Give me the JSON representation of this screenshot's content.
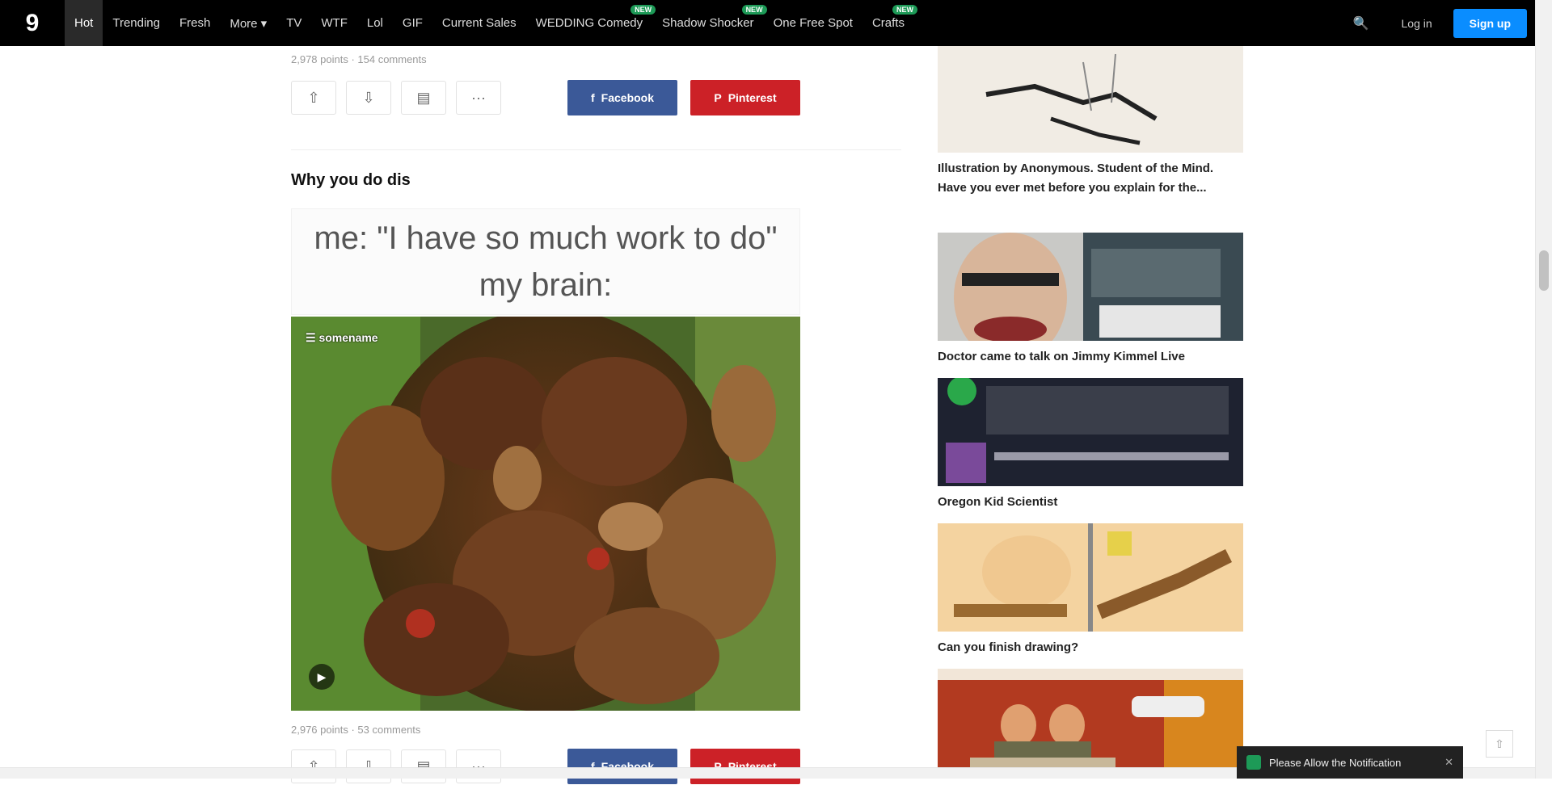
{
  "nav": {
    "logo": "9",
    "items": [
      {
        "label": "Hot",
        "active": true,
        "badge": ""
      },
      {
        "label": "Trending",
        "active": false,
        "badge": ""
      },
      {
        "label": "Fresh",
        "active": false,
        "badge": ""
      },
      {
        "label": "More ▾",
        "active": false,
        "badge": ""
      },
      {
        "label": "TV",
        "active": false,
        "badge": ""
      },
      {
        "label": "WTF",
        "active": false,
        "badge": ""
      },
      {
        "label": "Lol",
        "active": false,
        "badge": ""
      },
      {
        "label": "GIF",
        "active": false,
        "badge": ""
      },
      {
        "label": "Current Sales",
        "active": false,
        "badge": ""
      },
      {
        "label": "WEDDING Comedy",
        "active": false,
        "badge": "NEW"
      },
      {
        "label": "Shadow Shocker",
        "active": false,
        "badge": "NEW"
      },
      {
        "label": "One Free Spot",
        "active": false,
        "badge": ""
      },
      {
        "label": "Crafts",
        "active": false,
        "badge": "NEW"
      }
    ],
    "search_icon": "🔍",
    "login_label": "Log in",
    "signup_label": "Sign up"
  },
  "posts": [
    {
      "meta": "2,978 points · 154 comments",
      "facebook_label": "Facebook",
      "pinterest_label": "Pinterest"
    },
    {
      "title": "Why you do dis",
      "caption_line1": "me: \"I have so much work to do\"",
      "caption_line2": "my brain:",
      "watermark": "☰ somename",
      "play_icon": "▶",
      "meta": "2,976 points · 53 comments",
      "facebook_label": "Facebook",
      "pinterest_label": "Pinterest"
    }
  ],
  "vote_buttons": {
    "up": "⇧",
    "down": "⇩",
    "comment": "▤",
    "more": "···"
  },
  "sidebar": {
    "items": [
      {
        "title": "Illustration by Anonymous. Student of the Mind. Have you ever met before you explain for the..."
      },
      {
        "title": "Doctor came to talk on Jimmy Kimmel Live"
      },
      {
        "title": "Oregon Kid Scientist"
      },
      {
        "title": "Can you finish drawing?"
      },
      {
        "title": ""
      }
    ]
  },
  "toast": {
    "text": "Please Allow the Notification",
    "close": "✕"
  },
  "back_top": "⇧"
}
